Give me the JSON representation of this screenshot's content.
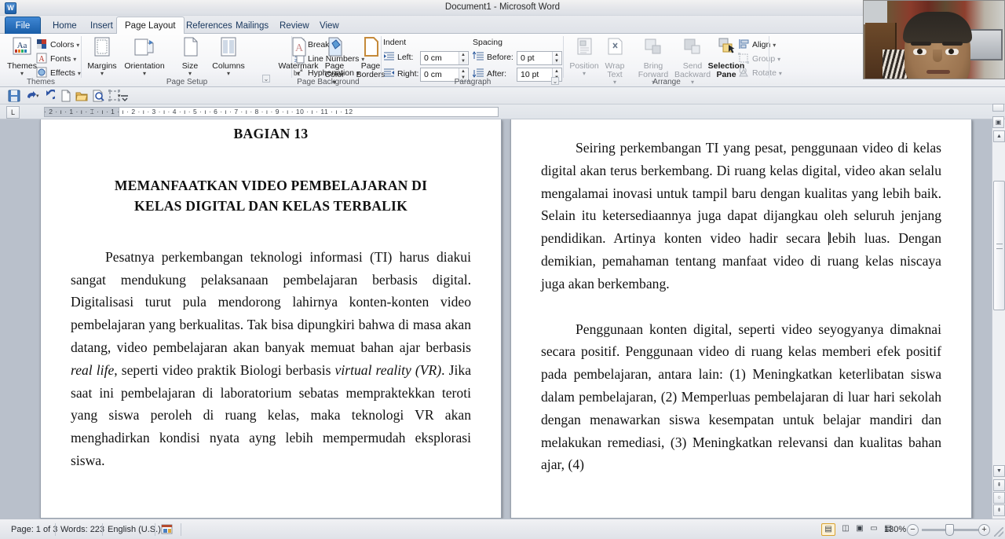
{
  "window": {
    "title": "Document1  -  Microsoft Word",
    "app_logo": "W"
  },
  "tabs": [
    {
      "label": "File",
      "state": "file"
    },
    {
      "label": "Home",
      "state": "normal"
    },
    {
      "label": "Insert",
      "state": "normal"
    },
    {
      "label": "Page Layout",
      "state": "active"
    },
    {
      "label": "References",
      "state": "normal"
    },
    {
      "label": "Mailings",
      "state": "normal"
    },
    {
      "label": "Review",
      "state": "normal"
    },
    {
      "label": "View",
      "state": "normal"
    }
  ],
  "quick_access": {
    "icons": [
      "save-icon",
      "undo-icon",
      "redo-icon",
      "new-document-icon",
      "open-folder-icon",
      "print-preview-icon",
      "object-icon",
      "customize-qat-icon"
    ]
  },
  "ribbon": {
    "groups": [
      {
        "name": "Themes",
        "label": "Themes",
        "big_buttons": [
          {
            "label": "Themes",
            "icon": "themes-icon",
            "has_dropdown": true
          }
        ],
        "small_buttons": [
          {
            "label": "Colors",
            "icon": "theme-colors-icon",
            "has_dropdown": true
          },
          {
            "label": "Fonts",
            "icon": "theme-fonts-icon",
            "has_dropdown": true
          },
          {
            "label": "Effects",
            "icon": "theme-effects-icon",
            "has_dropdown": true
          }
        ]
      },
      {
        "name": "Page Setup",
        "label": "Page Setup",
        "big_buttons": [
          {
            "label": "Margins",
            "icon": "margins-icon",
            "has_dropdown": true
          },
          {
            "label": "Orientation",
            "icon": "orientation-icon",
            "has_dropdown": true
          },
          {
            "label": "Size",
            "icon": "page-size-icon",
            "has_dropdown": true
          },
          {
            "label": "Columns",
            "icon": "columns-icon",
            "has_dropdown": true
          }
        ],
        "small_buttons": [
          {
            "label": "Breaks",
            "icon": "breaks-icon",
            "has_dropdown": true
          },
          {
            "label": "Line Numbers",
            "icon": "line-numbers-icon",
            "has_dropdown": true
          },
          {
            "label": "Hyphenation",
            "icon": "hyphenation-icon",
            "has_dropdown": true
          }
        ]
      },
      {
        "name": "Page Background",
        "label": "Page Background",
        "big_buttons": [
          {
            "label": "Watermark",
            "icon": "watermark-icon",
            "has_dropdown": true
          },
          {
            "label": "Page Color",
            "icon": "page-color-icon",
            "has_dropdown": true
          },
          {
            "label": "Page Borders",
            "icon": "page-borders-icon",
            "has_dropdown": false
          }
        ],
        "small_buttons": []
      },
      {
        "name": "Paragraph",
        "label": "Paragraph",
        "headings": {
          "indent": "Indent",
          "spacing": "Spacing"
        },
        "fields": [
          {
            "label": "Left:",
            "value": "0 cm",
            "icon": "indent-left-icon"
          },
          {
            "label": "Right:",
            "value": "0 cm",
            "icon": "indent-right-icon"
          },
          {
            "label": "Before:",
            "value": "0 pt",
            "icon": "spacing-before-icon"
          },
          {
            "label": "After:",
            "value": "10 pt",
            "icon": "spacing-after-icon"
          }
        ]
      },
      {
        "name": "Arrange",
        "label": "Arrange",
        "big_buttons": [
          {
            "label": "Position",
            "icon": "position-icon",
            "has_dropdown": true,
            "disabled": true
          },
          {
            "label": "Wrap Text",
            "icon": "wrap-text-icon",
            "has_dropdown": true,
            "disabled": true
          },
          {
            "label": "Bring Forward",
            "icon": "bring-forward-icon",
            "has_dropdown": true,
            "disabled": true
          },
          {
            "label": "Send Backward",
            "icon": "send-backward-icon",
            "has_dropdown": true,
            "disabled": true
          },
          {
            "label": "Selection Pane",
            "icon": "selection-pane-icon",
            "has_dropdown": false,
            "disabled": false
          }
        ],
        "small_buttons": [
          {
            "label": "Align",
            "icon": "align-icon",
            "has_dropdown": true,
            "disabled": false
          },
          {
            "label": "Group",
            "icon": "group-icon",
            "has_dropdown": true,
            "disabled": true
          },
          {
            "label": "Rotate",
            "icon": "rotate-icon",
            "has_dropdown": true,
            "disabled": true
          }
        ]
      }
    ]
  },
  "ruler": {
    "ticks": "·  2  ·  ı  ·  1  ·  ı  ·  ⌶  ·  ı  ·  1  ·  ı  ·  2  ·  ı  ·  3  ·  ı  ·  4  ·  ı  ·  5  ·  ı  ·  6  ·  ı  ·  7  ·  ı  ·  8  ·  ı  ·  9  ·  ı  ·  10  ·  ı  ·  11  ·  ı  ·  12",
    "corner_label": "L"
  },
  "document": {
    "left_page": {
      "chapter": "BAGIAN 13",
      "title_line1": "MEMANFAATKAN VIDEO PEMBELAJARAN DI",
      "title_line2": "KELAS DIGITAL DAN KELAS TERBALIK",
      "paragraph_before": "Pesatnya perkembangan teknologi informasi (TI) harus diakui sangat mendukung pelaksanaan pembelajaran berbasis digital. Digitalisasi turut pula mendorong lahirnya konten-konten video pembelajaran yang berkualitas. Tak bisa dipungkiri bahwa di masa akan datang, video pembelajaran akan banyak memuat bahan ajar berbasis ",
      "italic1": "real life",
      "paragraph_mid": ", seperti video praktik Biologi berbasis ",
      "italic2": "virtual reality (VR)",
      "paragraph_after": ". Jika saat ini pembelajaran di laboratorium sebatas mempraktekkan teroti yang siswa peroleh di ruang kelas, maka teknologi VR akan menghadirkan kondisi nyata ayng lebih mempermudah eksplorasi siswa."
    },
    "right_page": {
      "paragraph1_a": "Seiring perkembangan TI yang pesat, penggunaan video di kelas digital akan terus berkembang. Di ruang kelas digital, video akan selalu mengalamai inovasi untuk tampil baru dengan kualitas yang lebih baik. Selain itu ketersediaannya juga dapat dijangkau oleh seluruh jenjang pendidikan. Artinya konten video hadir secara ",
      "paragraph1_b": "lebih luas. Dengan demikian, pemahaman tentang manfaat video di ruang kelas niscaya juga akan berkembang.",
      "paragraph2": "Penggunaan konten digital, seperti video seyogyanya dimaknai secara positif. Penggunaan video di ruang kelas memberi efek positif pada pembelajaran, antara lain: (1) Meningkatkan keterlibatan siswa dalam pembelajaran, (2) Memperluas pembelajaran di luar hari sekolah dengan menawarkan siswa kesempatan untuk belajar mandiri dan melakukan remediasi, (3) Meningkatkan relevansi dan kualitas bahan ajar, (4)"
    }
  },
  "status_bar": {
    "page": "Page: 1 of 3",
    "words": "Words: 223",
    "language": "English (U.S.)",
    "macro_icon": "macro-record-icon",
    "view_buttons": [
      {
        "name": "print-layout-view",
        "glyph": "▤",
        "selected": true
      },
      {
        "name": "full-screen-reading-view",
        "glyph": "◫",
        "selected": false
      },
      {
        "name": "web-layout-view",
        "glyph": "▣",
        "selected": false
      },
      {
        "name": "outline-view",
        "glyph": "▭",
        "selected": false
      },
      {
        "name": "draft-view",
        "glyph": "▤",
        "selected": false
      }
    ],
    "zoom_level": "130%",
    "zoom_out_glyph": "−",
    "zoom_in_glyph": "+"
  },
  "scrollbar": {
    "up_glyph": "▲",
    "down_glyph": "▼",
    "prev_page_glyph": "⇞",
    "select_object_glyph": "○",
    "next_page_glyph": "⇟",
    "ruler_toggle_icon": "view-ruler-icon"
  },
  "webcam": {
    "name": "webcam-overlay"
  },
  "colors": {
    "accent": "#1a5ea8",
    "ribbon_bg": "#f3f4f7",
    "doc_bg": "#b9c0cb",
    "selection_orange": "#d9a22e"
  }
}
